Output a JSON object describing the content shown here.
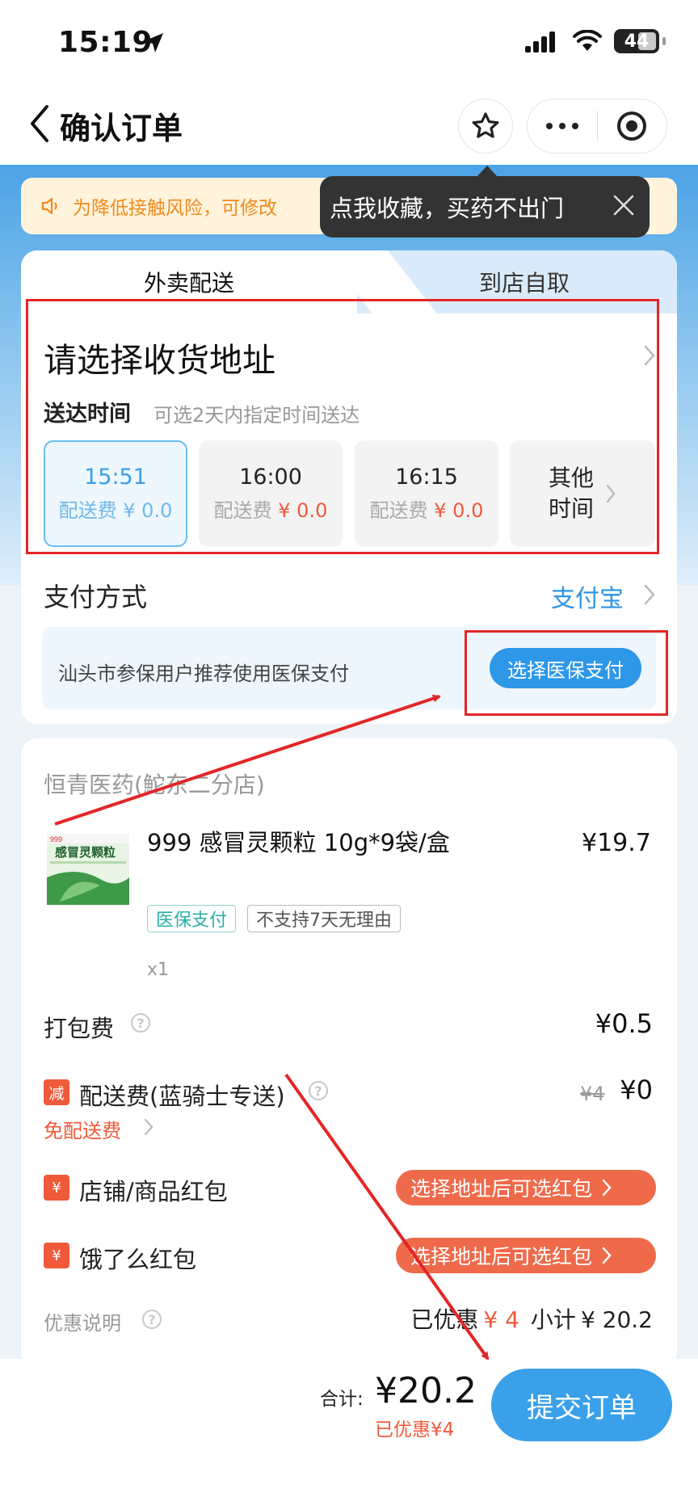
{
  "status_bar": {
    "time": "15:19",
    "battery": "44"
  },
  "nav": {
    "title": "确认订单"
  },
  "notice": {
    "text": "为降低接触风险，可修改"
  },
  "tooltip": {
    "text": "点我收藏，买药不出门"
  },
  "delivery": {
    "tabs": [
      "外卖配送",
      "到店自取"
    ],
    "address_prompt": "请选择收货地址",
    "time_label": "送达时间",
    "time_hint": "可选2天内指定时间送达",
    "slots": [
      {
        "time": "15:51",
        "fee_label": "配送费",
        "fee": "¥ 0.0"
      },
      {
        "time": "16:00",
        "fee_label": "配送费",
        "fee": "¥ 0.0"
      },
      {
        "time": "16:15",
        "fee_label": "配送费",
        "fee": "¥ 0.0"
      }
    ],
    "other_time": "其他时间"
  },
  "payment": {
    "label": "支付方式",
    "method": "支付宝",
    "med_hint": "汕头市参保用户推荐使用医保支付",
    "med_button": "选择医保支付"
  },
  "order": {
    "shop": "恒青医药(鮀东二分店)",
    "product": {
      "name": "999 感冒灵颗粒 10g*9袋/盒",
      "price": "¥19.7",
      "tags": [
        "医保支付",
        "不支持7天无理由"
      ],
      "qty": "x1",
      "image_text": "感冒灵颗粒",
      "image_brand": "999"
    },
    "packing": {
      "label": "打包费",
      "value": "¥0.5"
    },
    "shipping": {
      "badge": "减",
      "label": "配送费(蓝骑士专送)",
      "old": "¥4",
      "new": "¥0",
      "free_label": "免配送费"
    },
    "shop_red": {
      "badge": "¥",
      "label": "店铺/商品红包",
      "button": "选择地址后可选红包"
    },
    "ele_red": {
      "badge": "¥",
      "label": "饿了么红包",
      "button": "选择地址后可选红包"
    },
    "promo": {
      "label": "优惠说明",
      "discount_prefix": "已优惠",
      "discount": "¥ 4",
      "subtotal_prefix": "小计",
      "subtotal": "¥ 20.2"
    }
  },
  "footer": {
    "total_label": "合计:",
    "total": "¥20.2",
    "discount": "已优惠¥4",
    "submit": "提交订单"
  }
}
